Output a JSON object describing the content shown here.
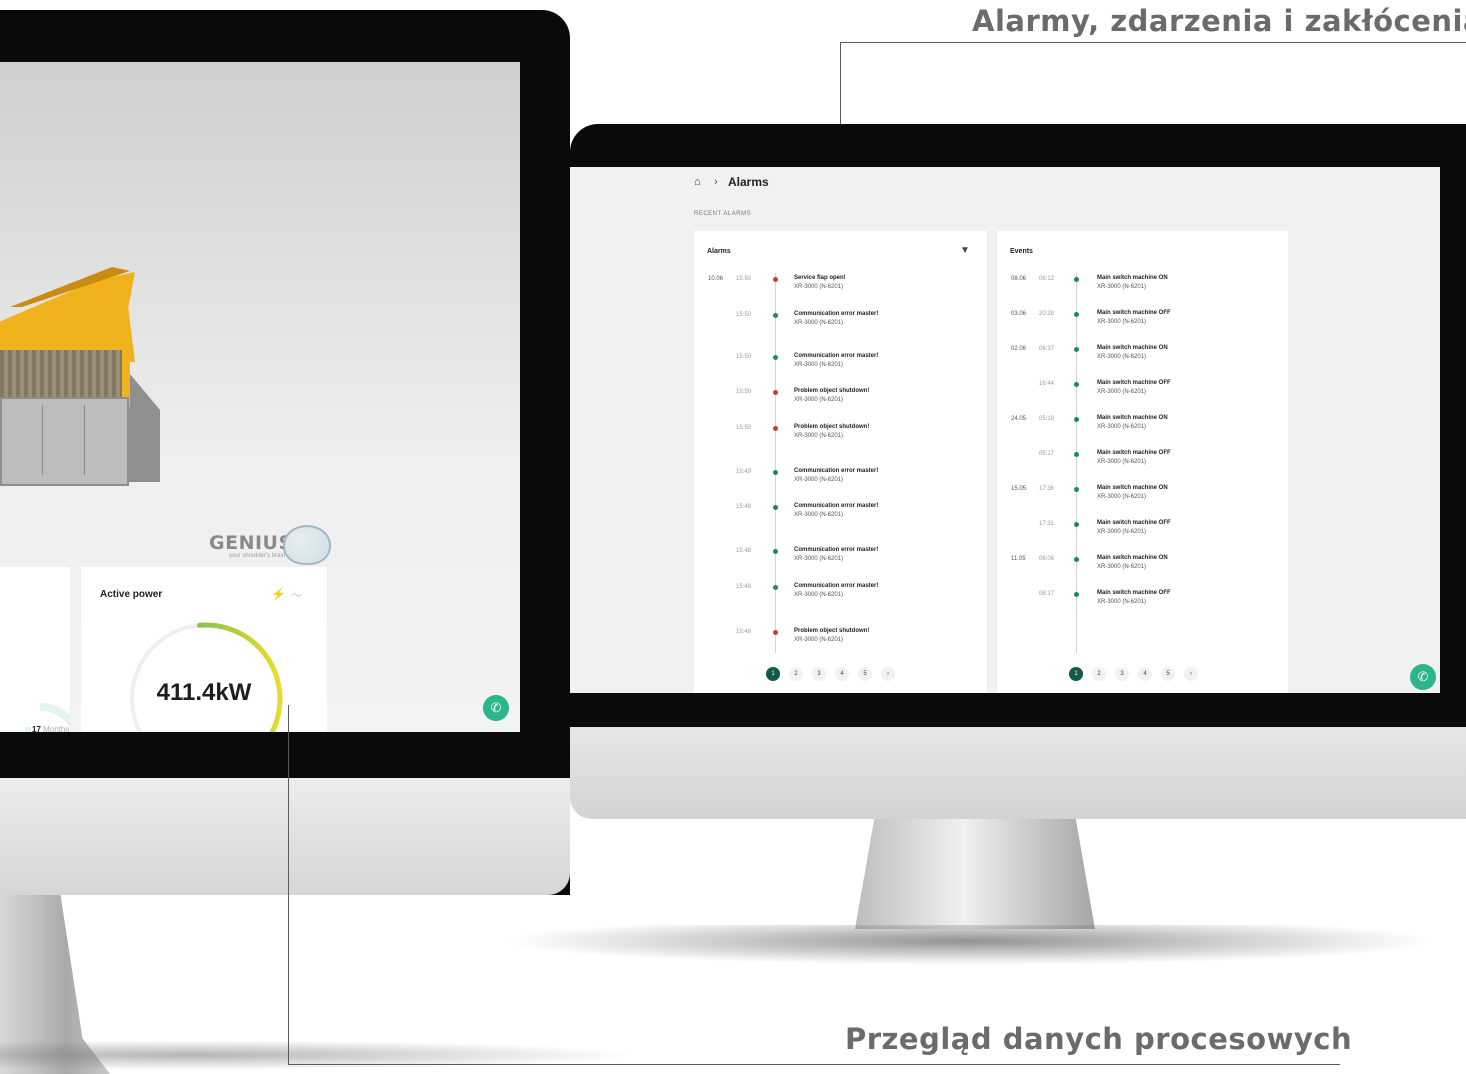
{
  "headings": {
    "top_right": "Alarmy, zdarzenia i zakłócenia",
    "bottom_right": "Przegląd danych procesowych"
  },
  "left_screen": {
    "brand": "GENIUS",
    "brand_sub": "your shredder's brain",
    "active_power": {
      "title": "Active power",
      "value": "411.4kW",
      "gauge_fraction": 0.38,
      "icons": [
        "bolt-icon",
        "trend-icon"
      ]
    },
    "months_label": "17",
    "months_unit": "Months",
    "call_icon": "phone-icon"
  },
  "right_screen": {
    "breadcrumb": {
      "home_icon": "home-icon",
      "separator": "›",
      "current": "Alarms"
    },
    "section_label": "RECENT ALARMS",
    "alarms": {
      "title": "Alarms",
      "filter_icon": "filter-icon",
      "items": [
        {
          "date": "10.06",
          "time": "15:50",
          "title": "Service flap open!",
          "device": "XR-3000 (N-6201)",
          "severity": "red"
        },
        {
          "date": "",
          "time": "15:50",
          "title": "Communication error master!",
          "device": "XR-3000 (N-6201)",
          "severity": "green"
        },
        {
          "date": "",
          "time": "15:50",
          "title": "Communication error master!",
          "device": "XR-3000 (N-6201)",
          "severity": "green"
        },
        {
          "date": "",
          "time": "15:50",
          "title": "Problem object shutdown!",
          "device": "XR-3000 (N-6201)",
          "severity": "red"
        },
        {
          "date": "",
          "time": "15:50",
          "title": "Problem object shutdown!",
          "device": "XR-3000 (N-6201)",
          "severity": "red"
        },
        {
          "date": "",
          "time": "15:49",
          "title": "Communication error master!",
          "device": "XR-3000 (N-6201)",
          "severity": "green"
        },
        {
          "date": "",
          "time": "15:49",
          "title": "Communication error master!",
          "device": "XR-3000 (N-6201)",
          "severity": "green"
        },
        {
          "date": "",
          "time": "15:48",
          "title": "Communication error master!",
          "device": "XR-3000 (N-6201)",
          "severity": "green"
        },
        {
          "date": "",
          "time": "15:48",
          "title": "Communication error master!",
          "device": "XR-3000 (N-6201)",
          "severity": "green"
        },
        {
          "date": "",
          "time": "15:48",
          "title": "Problem object shutdown!",
          "device": "XR-3000 (N-6201)",
          "severity": "red"
        }
      ],
      "pages": [
        "1",
        "2",
        "3",
        "4",
        "5",
        "›"
      ],
      "active_page": "1"
    },
    "events": {
      "title": "Events",
      "items": [
        {
          "date": "08.06",
          "time": "06:12",
          "title": "Main switch machine ON",
          "device": "XR-3000 (N-6201)"
        },
        {
          "date": "03.06",
          "time": "20:28",
          "title": "Main switch machine OFF",
          "device": "XR-3000 (N-6201)"
        },
        {
          "date": "02.06",
          "time": "06:37",
          "title": "Main switch machine ON",
          "device": "XR-3000 (N-6201)"
        },
        {
          "date": "",
          "time": "16:44",
          "title": "Main switch machine OFF",
          "device": "XR-3000 (N-6201)"
        },
        {
          "date": "24.05",
          "time": "05:19",
          "title": "Main switch machine ON",
          "device": "XR-3000 (N-6201)"
        },
        {
          "date": "",
          "time": "05:17",
          "title": "Main switch machine OFF",
          "device": "XR-3000 (N-6201)"
        },
        {
          "date": "15.05",
          "time": "17:36",
          "title": "Main switch machine ON",
          "device": "XR-3000 (N-6201)"
        },
        {
          "date": "",
          "time": "17:31",
          "title": "Main switch machine OFF",
          "device": "XR-3000 (N-6201)"
        },
        {
          "date": "11.05",
          "time": "06:06",
          "title": "Main switch machine ON",
          "device": "XR-3000 (N-6201)"
        },
        {
          "date": "",
          "time": "08:17",
          "title": "Main switch machine OFF",
          "device": "XR-3000 (N-6201)"
        }
      ],
      "pages": [
        "1",
        "2",
        "3",
        "4",
        "5",
        "›"
      ],
      "active_page": "1"
    },
    "call_icon": "phone-icon"
  },
  "colors": {
    "accent": "#135a4a",
    "status_green": "#1e8a5a",
    "status_red": "#d9343a",
    "call_button": "#2bb58a",
    "brand_yellow": "#f0b21b"
  }
}
